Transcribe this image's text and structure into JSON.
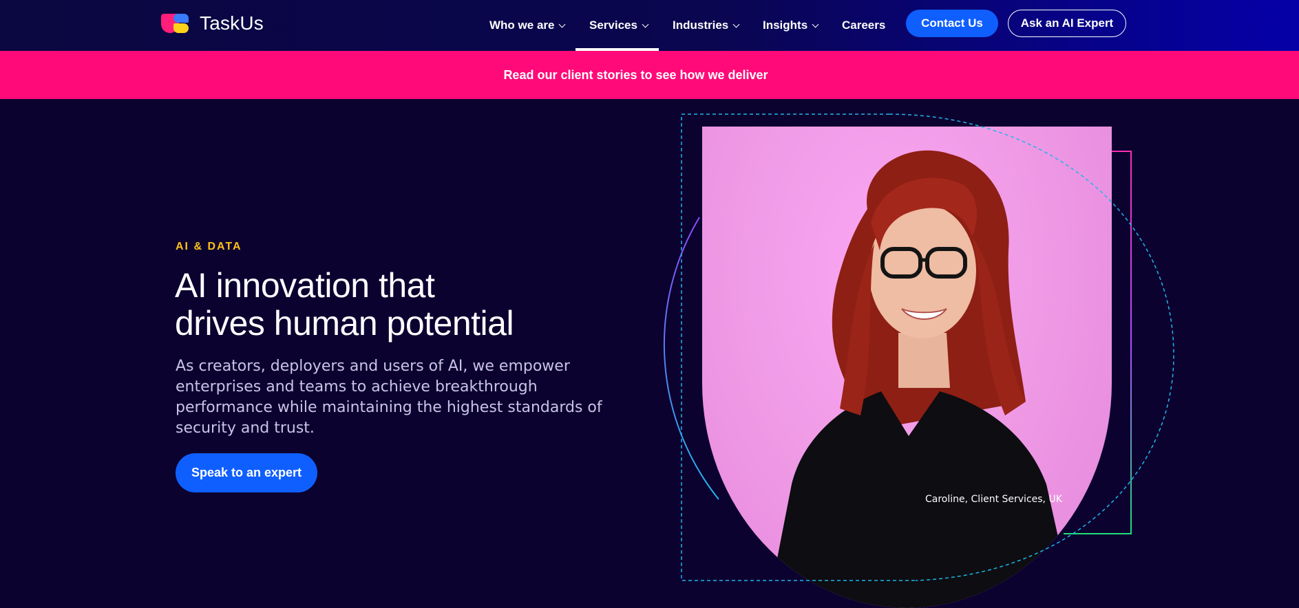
{
  "brand": {
    "name": "TaskUs",
    "colors": {
      "pink": "#ff1f7a",
      "blue": "#3a7bff",
      "yellow": "#ffd21a"
    }
  },
  "nav": {
    "items": [
      {
        "label": "Who we are",
        "has_dropdown": true,
        "active": false
      },
      {
        "label": "Services",
        "has_dropdown": true,
        "active": true
      },
      {
        "label": "Industries",
        "has_dropdown": true,
        "active": false
      },
      {
        "label": "Insights",
        "has_dropdown": true,
        "active": false
      },
      {
        "label": "Careers",
        "has_dropdown": false,
        "active": false
      }
    ],
    "contact_label": "Contact Us",
    "ai_expert_label": "Ask an AI Expert"
  },
  "promo": {
    "text": "Read our client stories to see how we deliver",
    "background": "#ff0a78"
  },
  "hero": {
    "eyebrow": "AI & DATA",
    "headline_line1": "AI innovation that",
    "headline_line2": "drives human potential",
    "body": "As creators, deployers and users of AI, we empower enterprises and teams to achieve breakthrough performance while maintaining the highest standards of security and trust.",
    "cta_label": "Speak to an expert",
    "photo_caption": "Caroline, Client Services, UK",
    "accent_colors": {
      "eyebrow": "#ffc21a",
      "cta": "#0f5fff",
      "dashed": "#1fb6e8"
    }
  }
}
